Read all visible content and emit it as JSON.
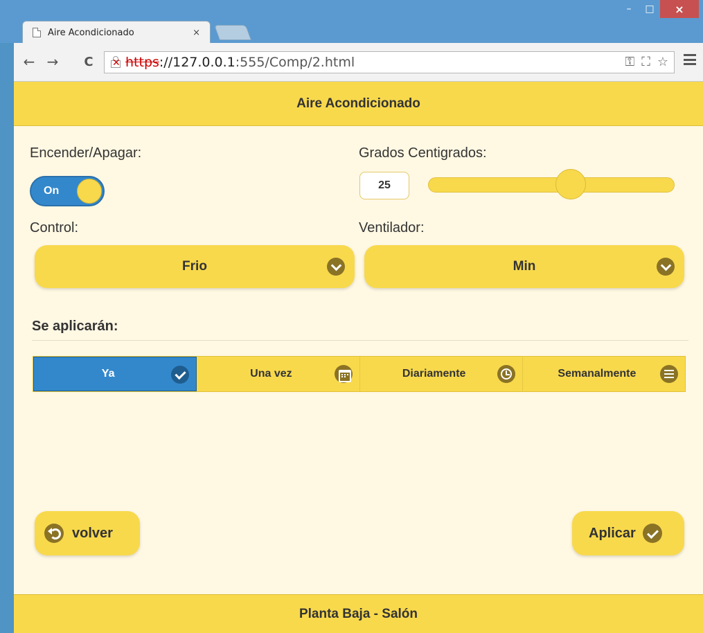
{
  "browser": {
    "tab_title": "Aire Acondicionado",
    "tab_close": "×",
    "url_scheme": "https",
    "url_rest": "://127.0.0.1",
    "url_port_path": ":555/Comp/2.html",
    "win_minimize": "–",
    "win_maximize": "□",
    "win_close": "×"
  },
  "header": {
    "title": "Aire Acondicionado"
  },
  "power": {
    "label": "Encender/Apagar:",
    "state_text": "On",
    "on": true
  },
  "temperature": {
    "label": "Grados Centigrados:",
    "value": "25",
    "slider_fraction": 0.58
  },
  "control": {
    "label": "Control:",
    "selected": "Frio"
  },
  "fan": {
    "label": "Ventilador:",
    "selected": "Min"
  },
  "schedule": {
    "title": "Se aplicarán:",
    "options": [
      {
        "label": "Ya",
        "icon": "check-icon",
        "active": true
      },
      {
        "label": "Una vez",
        "icon": "calendar-icon",
        "active": false
      },
      {
        "label": "Diariamente",
        "icon": "clock-icon",
        "active": false
      },
      {
        "label": "Semanalmente",
        "icon": "bars-icon",
        "active": false
      }
    ]
  },
  "actions": {
    "back_label": "volver",
    "apply_label": "Aplicar"
  },
  "footer": {
    "location": "Planta Baja - Salón"
  },
  "colors": {
    "accent": "#f8d94c",
    "active": "#3388cc",
    "background": "#fff8e3",
    "icon": "#8a7325"
  }
}
